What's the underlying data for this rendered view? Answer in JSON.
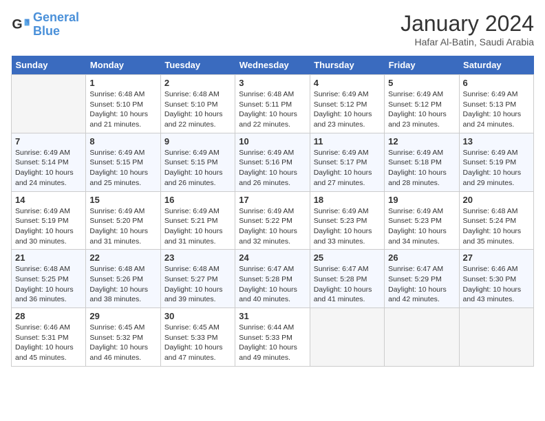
{
  "header": {
    "logo_line1": "General",
    "logo_line2": "Blue",
    "month": "January 2024",
    "location": "Hafar Al-Batin, Saudi Arabia"
  },
  "days_of_week": [
    "Sunday",
    "Monday",
    "Tuesday",
    "Wednesday",
    "Thursday",
    "Friday",
    "Saturday"
  ],
  "weeks": [
    [
      {
        "day": "",
        "info": ""
      },
      {
        "day": "1",
        "info": "Sunrise: 6:48 AM\nSunset: 5:10 PM\nDaylight: 10 hours\nand 21 minutes."
      },
      {
        "day": "2",
        "info": "Sunrise: 6:48 AM\nSunset: 5:10 PM\nDaylight: 10 hours\nand 22 minutes."
      },
      {
        "day": "3",
        "info": "Sunrise: 6:48 AM\nSunset: 5:11 PM\nDaylight: 10 hours\nand 22 minutes."
      },
      {
        "day": "4",
        "info": "Sunrise: 6:49 AM\nSunset: 5:12 PM\nDaylight: 10 hours\nand 23 minutes."
      },
      {
        "day": "5",
        "info": "Sunrise: 6:49 AM\nSunset: 5:12 PM\nDaylight: 10 hours\nand 23 minutes."
      },
      {
        "day": "6",
        "info": "Sunrise: 6:49 AM\nSunset: 5:13 PM\nDaylight: 10 hours\nand 24 minutes."
      }
    ],
    [
      {
        "day": "7",
        "info": "Sunrise: 6:49 AM\nSunset: 5:14 PM\nDaylight: 10 hours\nand 24 minutes."
      },
      {
        "day": "8",
        "info": "Sunrise: 6:49 AM\nSunset: 5:15 PM\nDaylight: 10 hours\nand 25 minutes."
      },
      {
        "day": "9",
        "info": "Sunrise: 6:49 AM\nSunset: 5:15 PM\nDaylight: 10 hours\nand 26 minutes."
      },
      {
        "day": "10",
        "info": "Sunrise: 6:49 AM\nSunset: 5:16 PM\nDaylight: 10 hours\nand 26 minutes."
      },
      {
        "day": "11",
        "info": "Sunrise: 6:49 AM\nSunset: 5:17 PM\nDaylight: 10 hours\nand 27 minutes."
      },
      {
        "day": "12",
        "info": "Sunrise: 6:49 AM\nSunset: 5:18 PM\nDaylight: 10 hours\nand 28 minutes."
      },
      {
        "day": "13",
        "info": "Sunrise: 6:49 AM\nSunset: 5:19 PM\nDaylight: 10 hours\nand 29 minutes."
      }
    ],
    [
      {
        "day": "14",
        "info": "Sunrise: 6:49 AM\nSunset: 5:19 PM\nDaylight: 10 hours\nand 30 minutes."
      },
      {
        "day": "15",
        "info": "Sunrise: 6:49 AM\nSunset: 5:20 PM\nDaylight: 10 hours\nand 31 minutes."
      },
      {
        "day": "16",
        "info": "Sunrise: 6:49 AM\nSunset: 5:21 PM\nDaylight: 10 hours\nand 31 minutes."
      },
      {
        "day": "17",
        "info": "Sunrise: 6:49 AM\nSunset: 5:22 PM\nDaylight: 10 hours\nand 32 minutes."
      },
      {
        "day": "18",
        "info": "Sunrise: 6:49 AM\nSunset: 5:23 PM\nDaylight: 10 hours\nand 33 minutes."
      },
      {
        "day": "19",
        "info": "Sunrise: 6:49 AM\nSunset: 5:23 PM\nDaylight: 10 hours\nand 34 minutes."
      },
      {
        "day": "20",
        "info": "Sunrise: 6:48 AM\nSunset: 5:24 PM\nDaylight: 10 hours\nand 35 minutes."
      }
    ],
    [
      {
        "day": "21",
        "info": "Sunrise: 6:48 AM\nSunset: 5:25 PM\nDaylight: 10 hours\nand 36 minutes."
      },
      {
        "day": "22",
        "info": "Sunrise: 6:48 AM\nSunset: 5:26 PM\nDaylight: 10 hours\nand 38 minutes."
      },
      {
        "day": "23",
        "info": "Sunrise: 6:48 AM\nSunset: 5:27 PM\nDaylight: 10 hours\nand 39 minutes."
      },
      {
        "day": "24",
        "info": "Sunrise: 6:47 AM\nSunset: 5:28 PM\nDaylight: 10 hours\nand 40 minutes."
      },
      {
        "day": "25",
        "info": "Sunrise: 6:47 AM\nSunset: 5:28 PM\nDaylight: 10 hours\nand 41 minutes."
      },
      {
        "day": "26",
        "info": "Sunrise: 6:47 AM\nSunset: 5:29 PM\nDaylight: 10 hours\nand 42 minutes."
      },
      {
        "day": "27",
        "info": "Sunrise: 6:46 AM\nSunset: 5:30 PM\nDaylight: 10 hours\nand 43 minutes."
      }
    ],
    [
      {
        "day": "28",
        "info": "Sunrise: 6:46 AM\nSunset: 5:31 PM\nDaylight: 10 hours\nand 45 minutes."
      },
      {
        "day": "29",
        "info": "Sunrise: 6:45 AM\nSunset: 5:32 PM\nDaylight: 10 hours\nand 46 minutes."
      },
      {
        "day": "30",
        "info": "Sunrise: 6:45 AM\nSunset: 5:33 PM\nDaylight: 10 hours\nand 47 minutes."
      },
      {
        "day": "31",
        "info": "Sunrise: 6:44 AM\nSunset: 5:33 PM\nDaylight: 10 hours\nand 49 minutes."
      },
      {
        "day": "",
        "info": ""
      },
      {
        "day": "",
        "info": ""
      },
      {
        "day": "",
        "info": ""
      }
    ]
  ]
}
